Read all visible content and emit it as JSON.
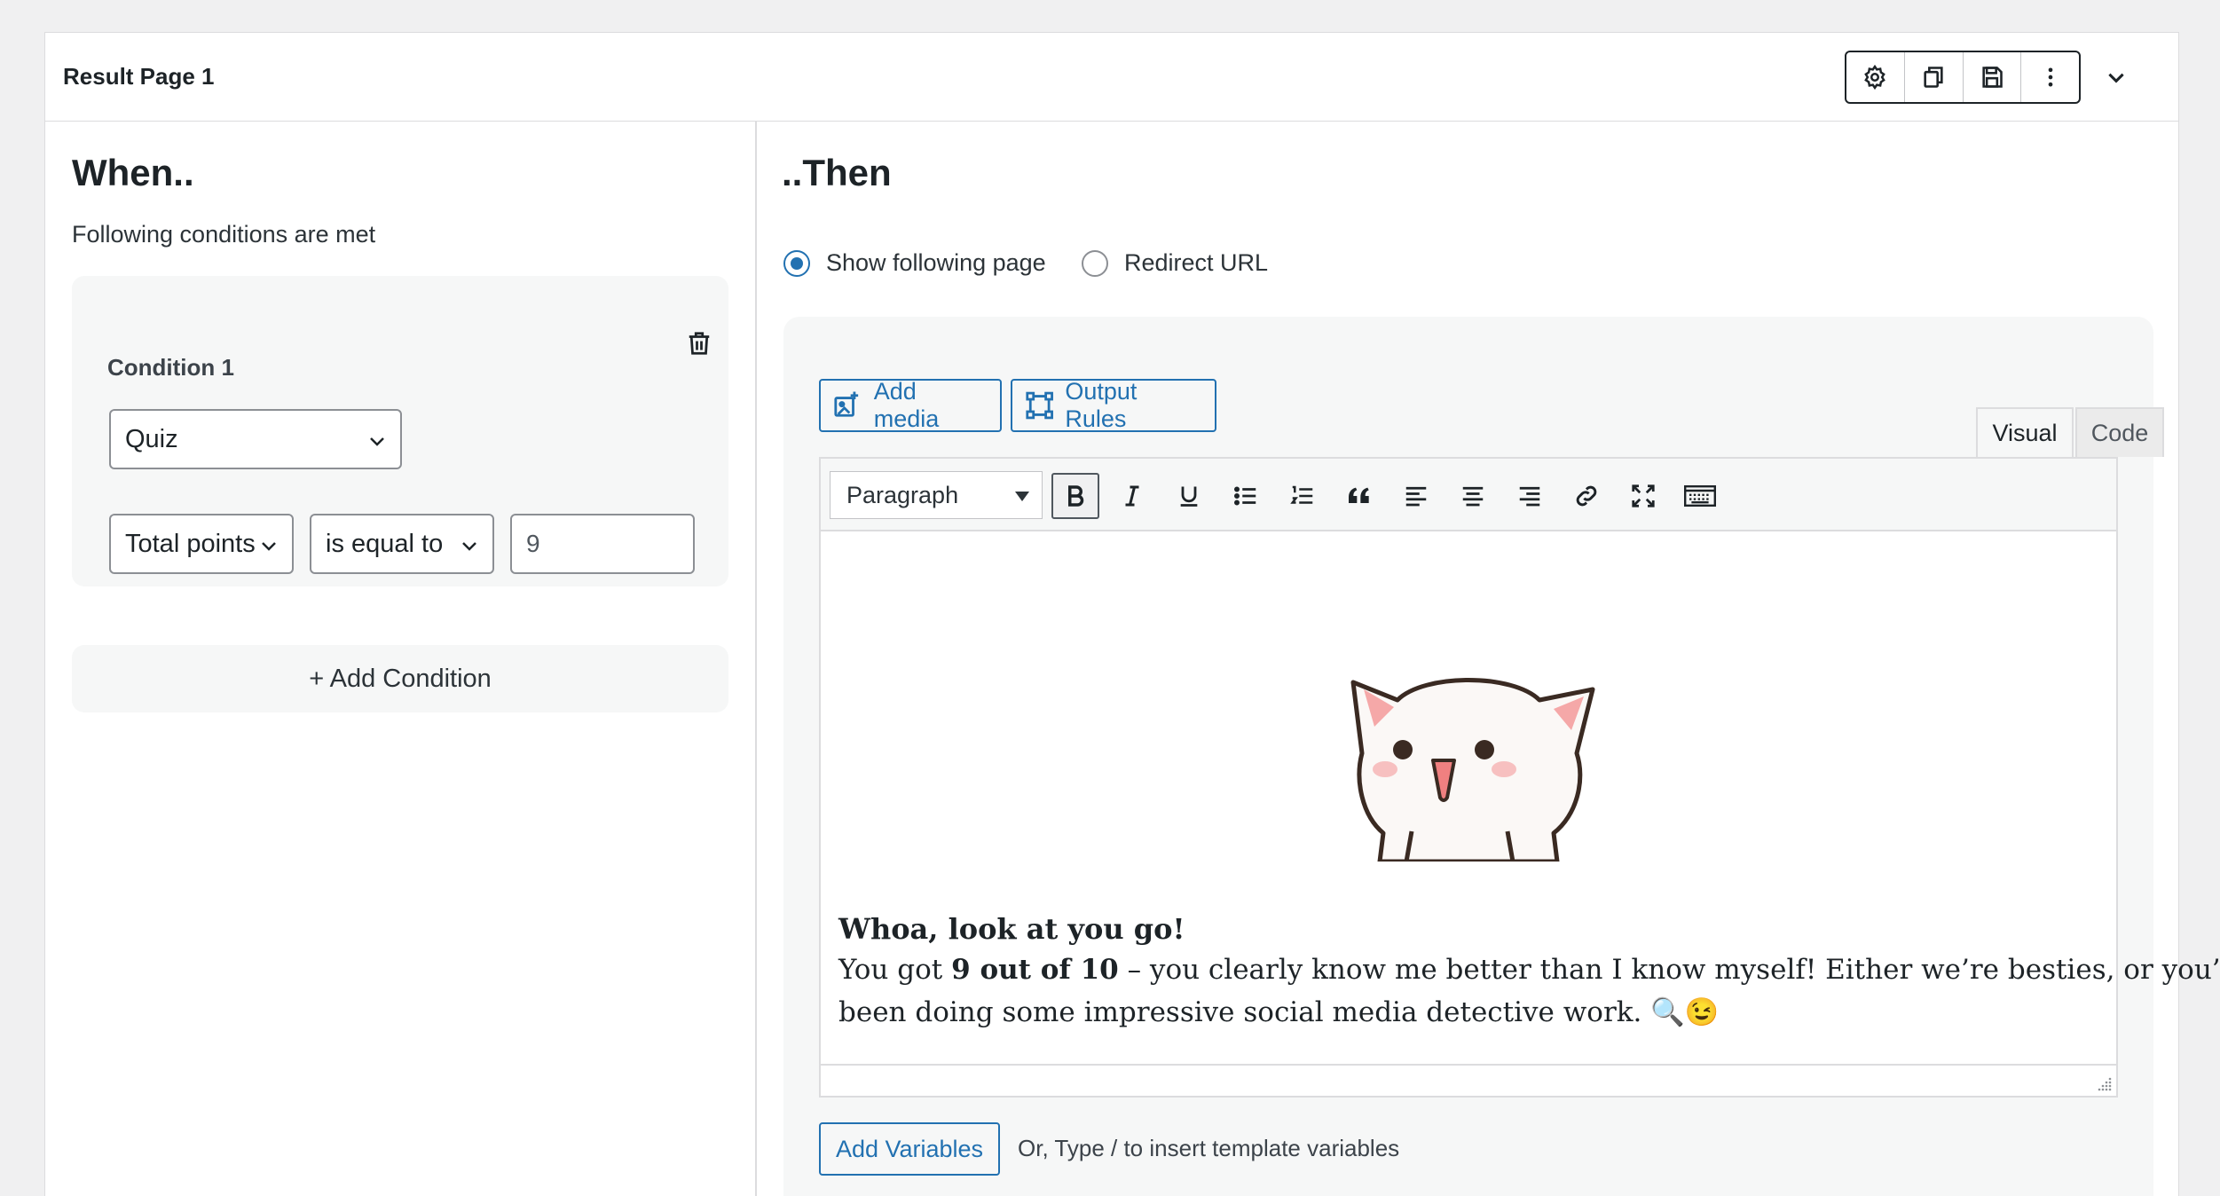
{
  "header": {
    "title": "Result Page 1",
    "icons": [
      "gear-icon",
      "duplicate-icon",
      "save-icon",
      "more-vertical-icon",
      "chevron-down-icon"
    ]
  },
  "when": {
    "heading": "When..",
    "subtitle": "Following conditions are met",
    "condition": {
      "title": "Condition 1",
      "source_select": "Quiz",
      "field_select": "Total points",
      "operator_select": "is equal to",
      "value": "9"
    },
    "add_condition_label": "+ Add Condition"
  },
  "then": {
    "heading": "..Then",
    "radio_show": "Show following page",
    "radio_redirect": "Redirect URL",
    "selected": "Show following page",
    "add_media_label": "Add media",
    "output_rules_label": "Output Rules",
    "tab_visual": "Visual",
    "tab_code": "Code",
    "format_select": "Paragraph",
    "toolbar_icons": [
      "bold-icon",
      "italic-icon",
      "underline-icon",
      "bullet-list-icon",
      "numbered-list-icon",
      "blockquote-icon",
      "align-left-icon",
      "align-center-icon",
      "align-right-icon",
      "link-icon",
      "fullscreen-icon",
      "keyboard-toolbar-icon"
    ],
    "content": {
      "headline": "Whoa, look at you go!",
      "line1_prefix": "You got ",
      "line1_bold": "9 out of 10",
      "line1_rest": " – you clearly know me better than I know myself! Either we’re besties, or you’ve",
      "line2": "been doing some impressive social media detective work. 🔍😉"
    },
    "add_variables_label": "Add Variables",
    "variables_hint": "Or, Type / to insert template variables"
  },
  "colors": {
    "accent": "#2271b1",
    "background": "#f0f0f1",
    "panel": "#ffffff",
    "subtle_box": "#f6f7f7"
  }
}
